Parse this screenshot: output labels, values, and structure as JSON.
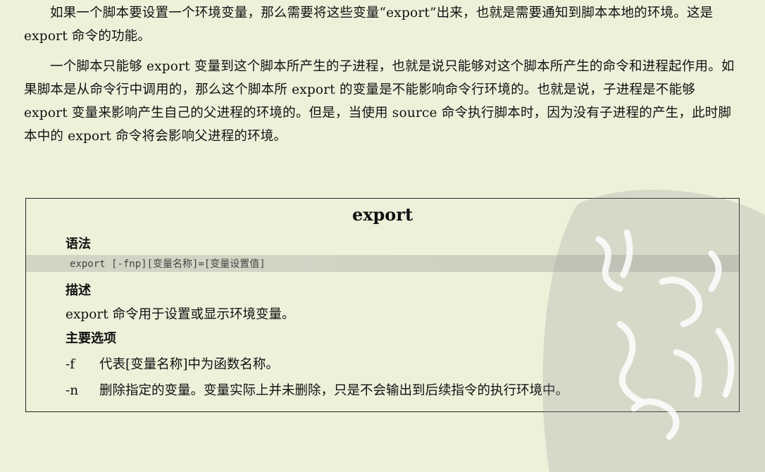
{
  "paragraphs": [
    "如果一个脚本要设置一个环境变量，那么需要将这些变量“export”出来，也就是需要通知到脚本本地的环境。这是 export 命令的功能。",
    "一个脚本只能够 export 变量到这个脚本所产生的子进程，也就是说只能够对这个脚本所产生的命令和进程起作用。如果脚本是从命令行中调用的，那么这个脚本所 export 的变量是不能影响命令行环境的。也就是说，子进程是不能够 export 变量来影响产生自己的父进程的环境的。但是，当使用 source 命令执行脚本时，因为没有子进程的产生，此时脚本中的 export 命令将会影响父进程的环境。"
  ],
  "box": {
    "title": "export",
    "syntax_heading": "语法",
    "syntax": "export [-fnp][变量名称]=[变量设置值]",
    "description_heading": "描述",
    "description": "export 命令用于设置或显示环境变量。",
    "options_heading": "主要选项",
    "options": [
      {
        "flag": "-f",
        "text": "代表[变量名称]中为函数名称。"
      },
      {
        "flag": "-n",
        "text": "删除指定的变量。变量实际上并未删除，只是不会输出到后续指令的执行环境中。"
      }
    ]
  },
  "colors": {
    "background": "#eef1da",
    "watermark": "#9a9a9a"
  }
}
